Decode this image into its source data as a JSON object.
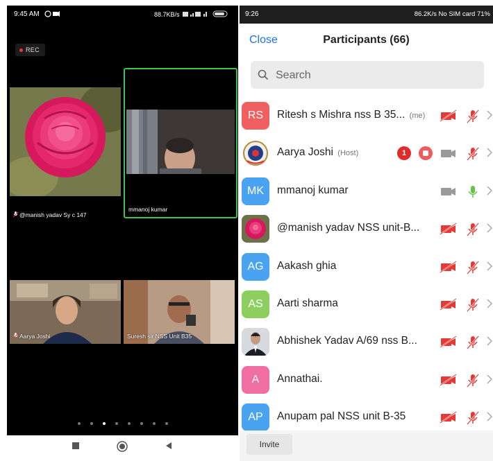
{
  "left_phone": {
    "status": {
      "time": "9:45 AM",
      "right": "88.7KB/s"
    },
    "rec_label": "REC",
    "tiles": {
      "manish": "@manish yadav Sy c 147",
      "mmanoj": "mmanoj kumar",
      "aarya": "Aarya Joshi",
      "suresh": "Suresh sir NSS Unit B35"
    },
    "pager": {
      "pages": 8,
      "active_index": 2
    },
    "nav": [
      "stop-square-icon",
      "home-circle-icon",
      "back-triangle-icon"
    ]
  },
  "right_phone": {
    "status": {
      "time": "9:26",
      "right": "86.2K/s   No SIM card   71%"
    },
    "close_label": "Close",
    "title": "Participants (66)",
    "search_placeholder": "Search",
    "participants": [
      {
        "avatar": "RS",
        "color": "#f06060",
        "name": "Ritesh s Mishra nss B 35...",
        "tag": "(me)",
        "video": "off",
        "mic": "muted"
      },
      {
        "avatar": "",
        "avatar_kind": "logo",
        "name": "Aarya Joshi",
        "tag": "(Host)",
        "badge": "1",
        "recording": true,
        "video": "on",
        "mic": "muted"
      },
      {
        "avatar": "MK",
        "color": "#4aa3f0",
        "name": "mmanoj kumar",
        "tag": "",
        "video": "on",
        "mic": "on"
      },
      {
        "avatar": "",
        "avatar_kind": "rose",
        "name": "@manish yadav NSS unit-B...",
        "tag": "",
        "video": "off",
        "mic": "muted"
      },
      {
        "avatar": "AG",
        "color": "#4aa3f0",
        "name": "Aakash ghia",
        "tag": "",
        "video": "off",
        "mic": "muted"
      },
      {
        "avatar": "AS",
        "color": "#8ccf5e",
        "name": "Aarti sharma",
        "tag": "",
        "video": "off",
        "mic": "muted"
      },
      {
        "avatar": "",
        "avatar_kind": "photo",
        "name": "Abhishek Yadav A/69 nss B...",
        "tag": "",
        "video": "off",
        "mic": "muted"
      },
      {
        "avatar": "A",
        "color": "#ef6fa0",
        "name": "Annathai.",
        "tag": "",
        "video": "off",
        "mic": "muted"
      },
      {
        "avatar": "AP",
        "color": "#4aa3f0",
        "name": "Anupam pal NSS unit B-35",
        "tag": "",
        "video": "off",
        "mic": "muted"
      }
    ],
    "invite_label": "Invite",
    "colors": {
      "accent": "#1a73e8",
      "muted_red": "#e53935",
      "mic_on": "#6cc04a",
      "video_on": "#9a9a9a"
    }
  }
}
